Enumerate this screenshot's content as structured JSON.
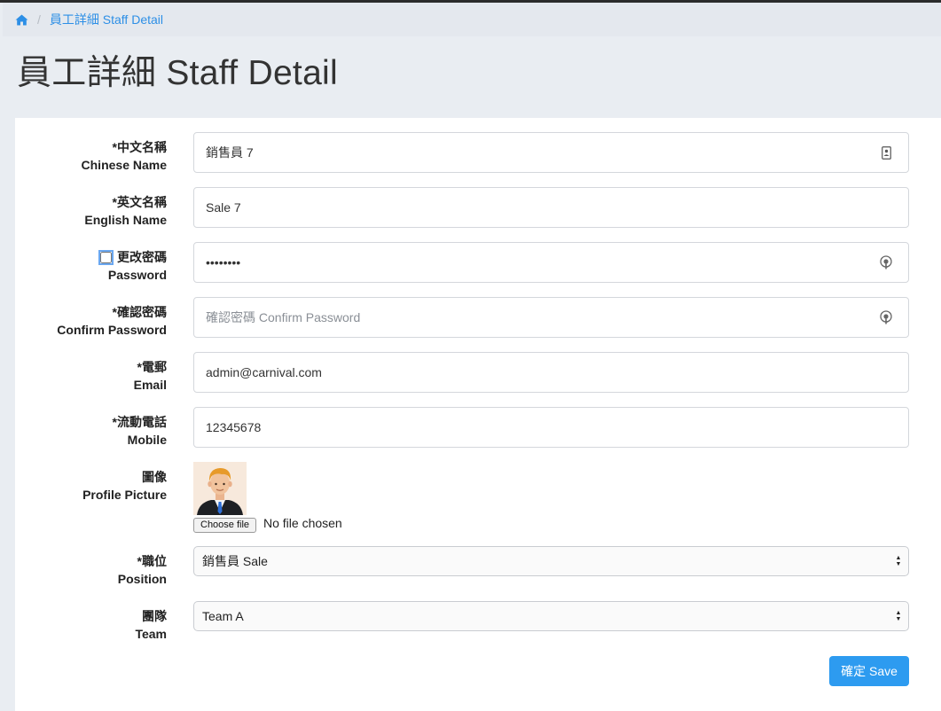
{
  "breadcrumb": {
    "home_icon": "home-icon",
    "current": "員工詳細 Staff Detail"
  },
  "page_title": "員工詳細 Staff Detail",
  "form": {
    "chinese_name": {
      "label_zh": "*中文名稱",
      "label_en": "Chinese Name",
      "value": "銷售員 7",
      "icon": "contact-card-icon"
    },
    "english_name": {
      "label_zh": "*英文名稱",
      "label_en": "English Name",
      "value": "Sale 7"
    },
    "password": {
      "label_zh": "更改密碼",
      "label_en": "Password",
      "value": "••••••••",
      "icon": "password-key-icon",
      "checkbox_checked": false
    },
    "confirm_password": {
      "label_zh": "*確認密碼",
      "label_en": "Confirm Password",
      "placeholder": "確認密碼 Confirm Password",
      "icon": "password-key-icon"
    },
    "email": {
      "label_zh": "*電郵",
      "label_en": "Email",
      "value": "admin@carnival.com"
    },
    "mobile": {
      "label_zh": "*流動電話",
      "label_en": "Mobile",
      "value": "12345678"
    },
    "profile_picture": {
      "label_zh": "圖像",
      "label_en": "Profile Picture",
      "file_button": "Choose file",
      "file_status": "No file chosen"
    },
    "position": {
      "label_zh": "*職位",
      "label_en": "Position",
      "selected": "銷售員 Sale"
    },
    "team": {
      "label_zh": "團隊",
      "label_en": "Team",
      "selected": "Team A"
    },
    "save_label": "確定 Save"
  },
  "colors": {
    "accent": "#2d9bf0",
    "link": "#2d8fe6",
    "background": "#e9edf2"
  }
}
